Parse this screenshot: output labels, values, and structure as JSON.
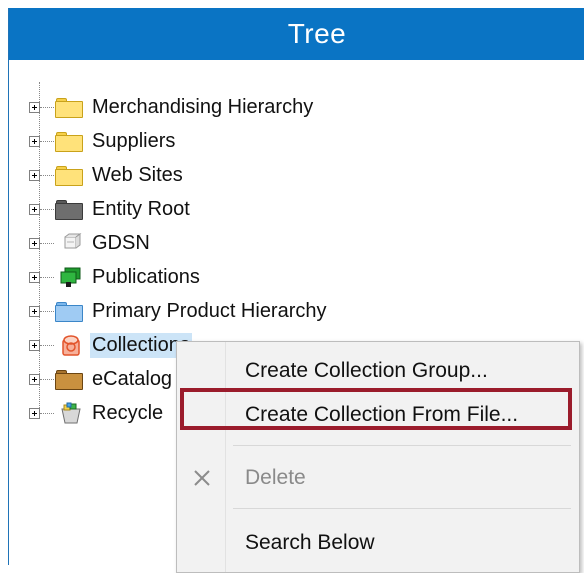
{
  "panel": {
    "title": "Tree"
  },
  "tree": {
    "items": [
      {
        "label": "Merchandising Hierarchy",
        "icon": "yellow-folder-icon"
      },
      {
        "label": "Suppliers",
        "icon": "yellow-folder-icon"
      },
      {
        "label": "Web Sites",
        "icon": "yellow-folder-icon"
      },
      {
        "label": "Entity Root",
        "icon": "gray-folder-icon"
      },
      {
        "label": "GDSN",
        "icon": "gdsn-cube-icon"
      },
      {
        "label": "Publications",
        "icon": "publications-icon"
      },
      {
        "label": "Primary Product Hierarchy",
        "icon": "blue-folder-icon"
      },
      {
        "label": "Collections",
        "icon": "collections-icon",
        "selected": true
      },
      {
        "label": "eCatalog",
        "icon": "brown-folder-icon"
      },
      {
        "label": "Recycle",
        "icon": "recycle-bin-icon"
      }
    ]
  },
  "context_menu": {
    "items": [
      {
        "label": "Create Collection Group..."
      },
      {
        "label": "Create Collection From File...",
        "highlighted": true
      },
      {
        "label": "Delete",
        "disabled": true,
        "icon": "delete-x-icon"
      },
      {
        "label": "Search Below"
      }
    ]
  },
  "colors": {
    "titlebar": "#0a74c4",
    "selection": "#cce4f7",
    "highlight_border": "#9b1c2c"
  }
}
